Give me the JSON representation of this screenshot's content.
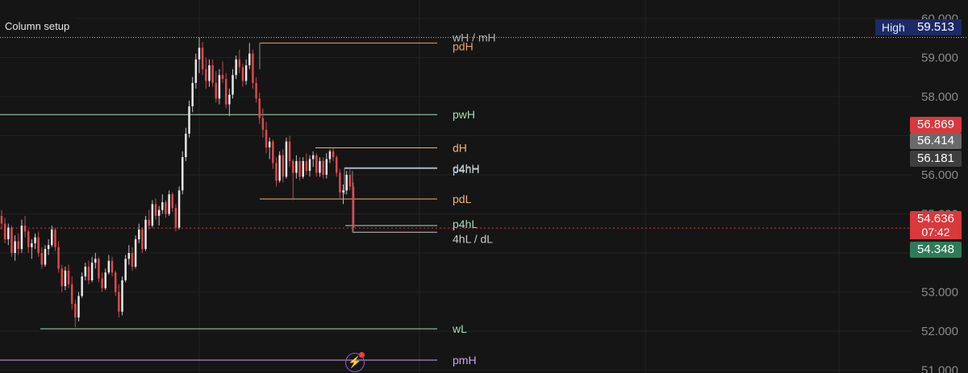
{
  "column_setup_label": "Column setup",
  "high_marker": {
    "label": "High",
    "value": "59.513",
    "color": "#1d2a66"
  },
  "price_tags": [
    {
      "value": "56.869",
      "price": 56.869,
      "bg": "#d9383c"
    },
    {
      "value": "56.414",
      "price": 56.414,
      "bg": "#6a6a6a"
    },
    {
      "value": "56.181",
      "price": 56.181,
      "bg": "#3e3e3e"
    },
    {
      "value": "54.636",
      "price": 54.636,
      "bg": "#d9383c",
      "countdown": "07:42"
    },
    {
      "value": "54.348",
      "price": 54.348,
      "bg": "#2f7a58"
    }
  ],
  "icons": {
    "flash": "lightning-icon",
    "notification": "notification-dot-icon"
  },
  "chart_data": {
    "type": "candlestick",
    "y_axis": {
      "ticks": [
        "60.000",
        "59.000",
        "58.000",
        "57.000",
        "56.000",
        "55.000",
        "54.000",
        "53.000",
        "52.000",
        "51.000"
      ],
      "tick_values": [
        60,
        59,
        58,
        57,
        56,
        55,
        54,
        53,
        52,
        51
      ],
      "range": [
        50.93,
        60.47
      ],
      "position": "right"
    },
    "current_price": 54.636,
    "grid": true,
    "levels": [
      {
        "label": "wH / mH",
        "price": 59.513,
        "color": "#b5b5b5",
        "style": "dotted-full"
      },
      {
        "label": "pdH",
        "price": 59.37,
        "color": "#e8a165"
      },
      {
        "label": "pwH",
        "price": 57.54,
        "color": "#a6dcb8"
      },
      {
        "label": "dH",
        "price": 56.69,
        "color": "#f0b47c"
      },
      {
        "label": "p4hH",
        "price": 56.18,
        "color": "#a6c8ee"
      },
      {
        "label": "d4hH",
        "price": 56.16,
        "color": "#c8c8c8"
      },
      {
        "label": "pdL",
        "price": 55.38,
        "color": "#f0b47c"
      },
      {
        "label": "p4hL",
        "price": 54.7,
        "color": "#a6dcb8"
      },
      {
        "label": "4hL / dL",
        "price": 54.53,
        "color": "#c8c8c8"
      },
      {
        "label": "wL",
        "price": 52.06,
        "color": "#a6dcb8"
      },
      {
        "label": "pmH",
        "price": 51.26,
        "color": "#c6a6f0"
      }
    ],
    "candles": [
      [
        54.95,
        55.1,
        54.6,
        54.75
      ],
      [
        54.75,
        54.9,
        54.25,
        54.35
      ],
      [
        54.35,
        54.75,
        54.2,
        54.65
      ],
      [
        54.65,
        54.7,
        53.9,
        54.0
      ],
      [
        54.0,
        54.45,
        53.8,
        54.3
      ],
      [
        54.3,
        54.5,
        53.95,
        54.1
      ],
      [
        54.1,
        54.85,
        54.0,
        54.7
      ],
      [
        54.7,
        54.95,
        54.4,
        54.55
      ],
      [
        54.55,
        54.6,
        54.0,
        54.15
      ],
      [
        54.15,
        54.35,
        53.85,
        54.25
      ],
      [
        54.25,
        54.5,
        54.1,
        54.4
      ],
      [
        54.4,
        54.55,
        53.9,
        54.0
      ],
      [
        54.0,
        54.15,
        53.6,
        53.7
      ],
      [
        53.7,
        54.2,
        53.65,
        54.1
      ],
      [
        54.1,
        54.35,
        53.95,
        54.2
      ],
      [
        54.2,
        54.7,
        54.15,
        54.6
      ],
      [
        54.6,
        54.65,
        54.05,
        54.15
      ],
      [
        54.15,
        54.3,
        53.5,
        53.6
      ],
      [
        53.6,
        53.7,
        53.0,
        53.15
      ],
      [
        53.15,
        53.65,
        53.05,
        53.55
      ],
      [
        53.55,
        53.7,
        53.1,
        53.2
      ],
      [
        53.2,
        53.4,
        52.55,
        52.7
      ],
      [
        52.7,
        52.8,
        52.1,
        52.35
      ],
      [
        52.35,
        53.0,
        52.25,
        52.9
      ],
      [
        52.9,
        53.5,
        52.85,
        53.4
      ],
      [
        53.4,
        53.75,
        53.3,
        53.65
      ],
      [
        53.65,
        53.8,
        53.2,
        53.3
      ],
      [
        53.3,
        53.9,
        53.25,
        53.75
      ],
      [
        53.75,
        54.0,
        53.6,
        53.85
      ],
      [
        53.85,
        53.9,
        53.25,
        53.35
      ],
      [
        53.35,
        53.5,
        53.0,
        53.1
      ],
      [
        53.1,
        53.6,
        53.05,
        53.5
      ],
      [
        53.5,
        53.95,
        53.45,
        53.8
      ],
      [
        53.8,
        53.9,
        53.4,
        53.5
      ],
      [
        53.5,
        53.55,
        52.9,
        53.0
      ],
      [
        53.0,
        53.2,
        52.35,
        52.5
      ],
      [
        52.5,
        53.4,
        52.4,
        53.3
      ],
      [
        53.3,
        53.95,
        53.25,
        53.85
      ],
      [
        53.85,
        54.2,
        53.7,
        54.0
      ],
      [
        54.0,
        54.15,
        53.55,
        53.65
      ],
      [
        53.65,
        54.45,
        53.6,
        54.35
      ],
      [
        54.35,
        54.75,
        54.25,
        54.6
      ],
      [
        54.6,
        54.65,
        54.0,
        54.1
      ],
      [
        54.1,
        54.95,
        54.05,
        54.85
      ],
      [
        54.85,
        55.1,
        54.6,
        54.7
      ],
      [
        54.7,
        55.35,
        54.65,
        55.25
      ],
      [
        55.25,
        55.4,
        54.85,
        54.95
      ],
      [
        54.95,
        55.2,
        54.7,
        55.1
      ],
      [
        55.1,
        55.5,
        55.0,
        55.3
      ],
      [
        55.3,
        55.35,
        54.9,
        55.0
      ],
      [
        55.0,
        55.6,
        54.95,
        55.5
      ],
      [
        55.5,
        55.55,
        55.05,
        55.15
      ],
      [
        55.15,
        55.25,
        54.55,
        54.65
      ],
      [
        54.65,
        55.7,
        54.6,
        55.6
      ],
      [
        55.6,
        56.6,
        55.5,
        56.45
      ],
      [
        56.45,
        57.2,
        56.35,
        57.05
      ],
      [
        57.05,
        57.9,
        56.95,
        57.75
      ],
      [
        57.75,
        58.5,
        57.6,
        58.35
      ],
      [
        58.35,
        59.1,
        58.2,
        58.95
      ],
      [
        58.95,
        59.51,
        58.6,
        59.25
      ],
      [
        59.25,
        59.4,
        58.55,
        58.7
      ],
      [
        58.7,
        59.0,
        58.2,
        58.4
      ],
      [
        58.4,
        58.95,
        58.25,
        58.8
      ],
      [
        58.8,
        58.95,
        58.25,
        58.35
      ],
      [
        58.35,
        58.65,
        57.85,
        57.95
      ],
      [
        57.95,
        58.7,
        57.8,
        58.55
      ],
      [
        58.55,
        58.9,
        58.35,
        58.45
      ],
      [
        58.45,
        58.6,
        57.7,
        57.8
      ],
      [
        57.8,
        58.2,
        57.5,
        58.05
      ],
      [
        58.05,
        58.7,
        57.95,
        58.55
      ],
      [
        58.55,
        59.05,
        58.45,
        58.95
      ],
      [
        58.95,
        59.2,
        58.6,
        58.75
      ],
      [
        58.75,
        58.85,
        58.25,
        58.4
      ],
      [
        58.4,
        58.95,
        58.3,
        58.8
      ],
      [
        58.8,
        59.37,
        58.7,
        59.1
      ],
      [
        59.1,
        59.2,
        58.2,
        58.35
      ],
      [
        58.35,
        58.5,
        57.85,
        57.95
      ],
      [
        57.95,
        58.1,
        57.3,
        57.45
      ],
      [
        57.45,
        57.7,
        56.95,
        57.15
      ],
      [
        57.15,
        57.35,
        56.55,
        56.7
      ],
      [
        56.7,
        56.95,
        56.4,
        56.85
      ],
      [
        56.85,
        56.9,
        56.15,
        56.3
      ],
      [
        56.3,
        56.45,
        55.7,
        55.85
      ],
      [
        55.85,
        56.6,
        55.8,
        56.5
      ],
      [
        56.5,
        56.65,
        55.8,
        55.95
      ],
      [
        55.95,
        56.95,
        55.9,
        56.85
      ],
      [
        56.85,
        57.0,
        56.2,
        56.35
      ],
      [
        56.35,
        56.4,
        55.35,
        56.05
      ],
      [
        56.05,
        56.5,
        55.9,
        56.35
      ],
      [
        56.35,
        56.45,
        55.85,
        55.95
      ],
      [
        55.95,
        56.45,
        55.9,
        56.35
      ],
      [
        56.35,
        56.55,
        56.0,
        56.1
      ],
      [
        56.1,
        56.5,
        55.95,
        56.4
      ],
      [
        56.4,
        56.6,
        56.2,
        56.5
      ],
      [
        56.5,
        56.55,
        55.95,
        56.05
      ],
      [
        56.05,
        56.45,
        55.95,
        56.35
      ],
      [
        56.35,
        56.45,
        55.9,
        56.0
      ],
      [
        56.0,
        56.55,
        55.9,
        56.4
      ],
      [
        56.4,
        56.65,
        56.3,
        56.6
      ],
      [
        56.6,
        56.69,
        56.35,
        56.45
      ],
      [
        56.45,
        56.5,
        55.95,
        56.05
      ],
      [
        56.05,
        56.15,
        55.4,
        55.55
      ],
      [
        55.55,
        55.75,
        55.25,
        55.6
      ],
      [
        55.6,
        56.1,
        55.5,
        56.0
      ],
      [
        56.0,
        56.16,
        55.6,
        55.7
      ],
      [
        55.7,
        55.8,
        54.55,
        54.636
      ]
    ]
  }
}
